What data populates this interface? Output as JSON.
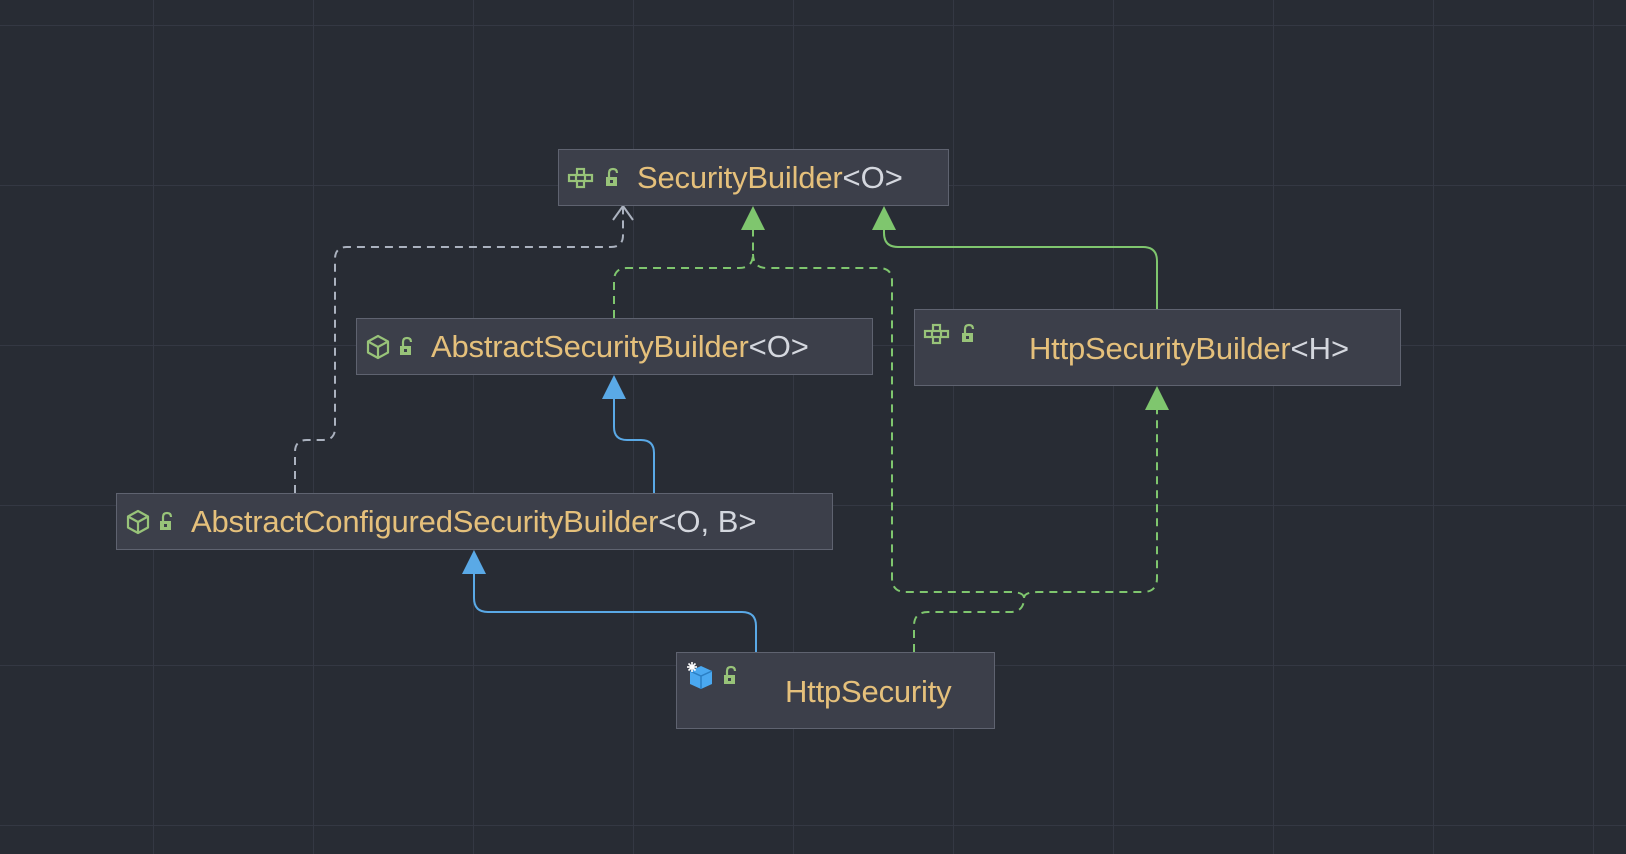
{
  "diagram": {
    "nodes": [
      {
        "id": "securitybuilder",
        "kind": "interface",
        "visibility": "public",
        "name": "SecurityBuilder",
        "generic": "<O>"
      },
      {
        "id": "abstractsecuritybuilder",
        "kind": "abstract-class",
        "visibility": "public",
        "name": "AbstractSecurityBuilder",
        "generic": "<O>"
      },
      {
        "id": "httpsecuritybuilder",
        "kind": "interface",
        "visibility": "public",
        "name": "HttpSecurityBuilder",
        "generic": "<H>"
      },
      {
        "id": "abstractconfiguredsecuritybuilder",
        "kind": "abstract-class",
        "visibility": "public",
        "name": "AbstractConfiguredSecurityBuilder",
        "generic": "<O, B>"
      },
      {
        "id": "httpsecurity",
        "kind": "final-class",
        "visibility": "public",
        "name": "HttpSecurity",
        "generic": ""
      }
    ],
    "edges": [
      {
        "from": "abstractconfiguredsecuritybuilder",
        "to": "securitybuilder",
        "relation": "dependency",
        "style": "dashed",
        "color": "#abb2bf"
      },
      {
        "from": "abstractsecuritybuilder",
        "to": "securitybuilder",
        "relation": "implements",
        "style": "dashed",
        "color": "#7fc66e"
      },
      {
        "from": "httpsecurity",
        "to": "securitybuilder",
        "relation": "implements",
        "style": "dashed",
        "color": "#7fc66e"
      },
      {
        "from": "httpsecuritybuilder",
        "to": "securitybuilder",
        "relation": "extends",
        "style": "solid",
        "color": "#7fc66e"
      },
      {
        "from": "abstractconfiguredsecuritybuilder",
        "to": "abstractsecuritybuilder",
        "relation": "extends",
        "style": "solid",
        "color": "#5aa9e6"
      },
      {
        "from": "httpsecurity",
        "to": "abstractconfiguredsecuritybuilder",
        "relation": "extends",
        "style": "solid",
        "color": "#5aa9e6"
      },
      {
        "from": "httpsecurity",
        "to": "httpsecuritybuilder",
        "relation": "implements",
        "style": "dashed",
        "color": "#7fc66e"
      }
    ]
  },
  "colors": {
    "background": "#282c34",
    "node_fill": "#3c3f4a",
    "node_border": "#5f6370",
    "class_name": "#e5c07b",
    "generic_params": "#d4d7de",
    "icon_green": "#98c379",
    "icon_blue": "#4aa8f0"
  },
  "icons": {
    "interface": "interface-icon",
    "abstract-class": "abstract-class-icon",
    "final-class": "final-class-icon",
    "public": "unlocked-icon"
  }
}
